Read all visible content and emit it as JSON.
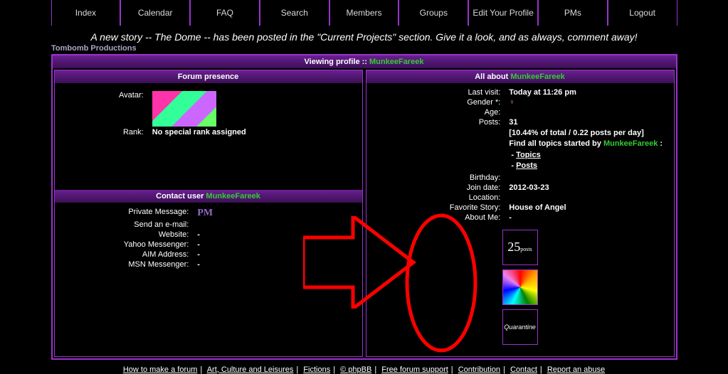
{
  "nav": [
    "Index",
    "Calendar",
    "FAQ",
    "Search",
    "Members",
    "Groups",
    "Edit Your Profile",
    "PMs",
    "Logout"
  ],
  "announce": "A new story -- The Dome -- has been posted in the \"Current Projects\" section. Give it a look, and as always, comment away!",
  "site_name": "Tombomb Productions",
  "viewing_prefix": "Viewing profile :: ",
  "username": "MunkeeFareek",
  "left_header": "Forum presence",
  "right_header_prefix": "All about ",
  "presence": {
    "avatar_lbl": "Avatar:",
    "rank_lbl": "Rank:",
    "rank_val": "No special rank assigned"
  },
  "contact_hdr_prefix": "Contact user ",
  "contact": {
    "pm_lbl": "Private Message:",
    "pm_btn": "PM",
    "email_lbl": "Send an e-mail:",
    "website_lbl": "Website:",
    "website_val": "-",
    "yahoo_lbl": "Yahoo Messenger:",
    "yahoo_val": "-",
    "aim_lbl": "AIM Address:",
    "aim_val": "-",
    "msn_lbl": "MSN Messenger:",
    "msn_val": "-"
  },
  "about": {
    "lastvisit_lbl": "Last visit:",
    "lastvisit_val": "Today at 11:26 pm",
    "gender_lbl": "Gender *:",
    "gender_icon": "female-icon",
    "age_lbl": "Age:",
    "age_val": "",
    "posts_lbl": "Posts:",
    "posts_val": "31",
    "stats_line": "[10.44% of total / 0.22 posts per day]",
    "find_prefix": "Find all topics started by ",
    "find_suffix": " :",
    "topics_link": "Topics",
    "posts_link": "Posts",
    "birthday_lbl": "Birthday:",
    "birthday_val": "",
    "join_lbl": "Join date:",
    "join_val": "2012-03-23",
    "location_lbl": "Location:",
    "location_val": "",
    "favstory_lbl": "Favorite Story:",
    "favstory_val": "House of Angel",
    "aboutme_lbl": "About Me:",
    "aboutme_val": "-"
  },
  "badges": {
    "b1_num": "25",
    "b1_txt": "posts",
    "b3_txt": "Quarantine"
  },
  "footer": {
    "links": [
      "How to make a forum",
      "Art, Culture and Leisures",
      "Fictions",
      "© phpBB",
      "Free forum support",
      "Contribution",
      "Contact",
      "Report an abuse"
    ]
  }
}
